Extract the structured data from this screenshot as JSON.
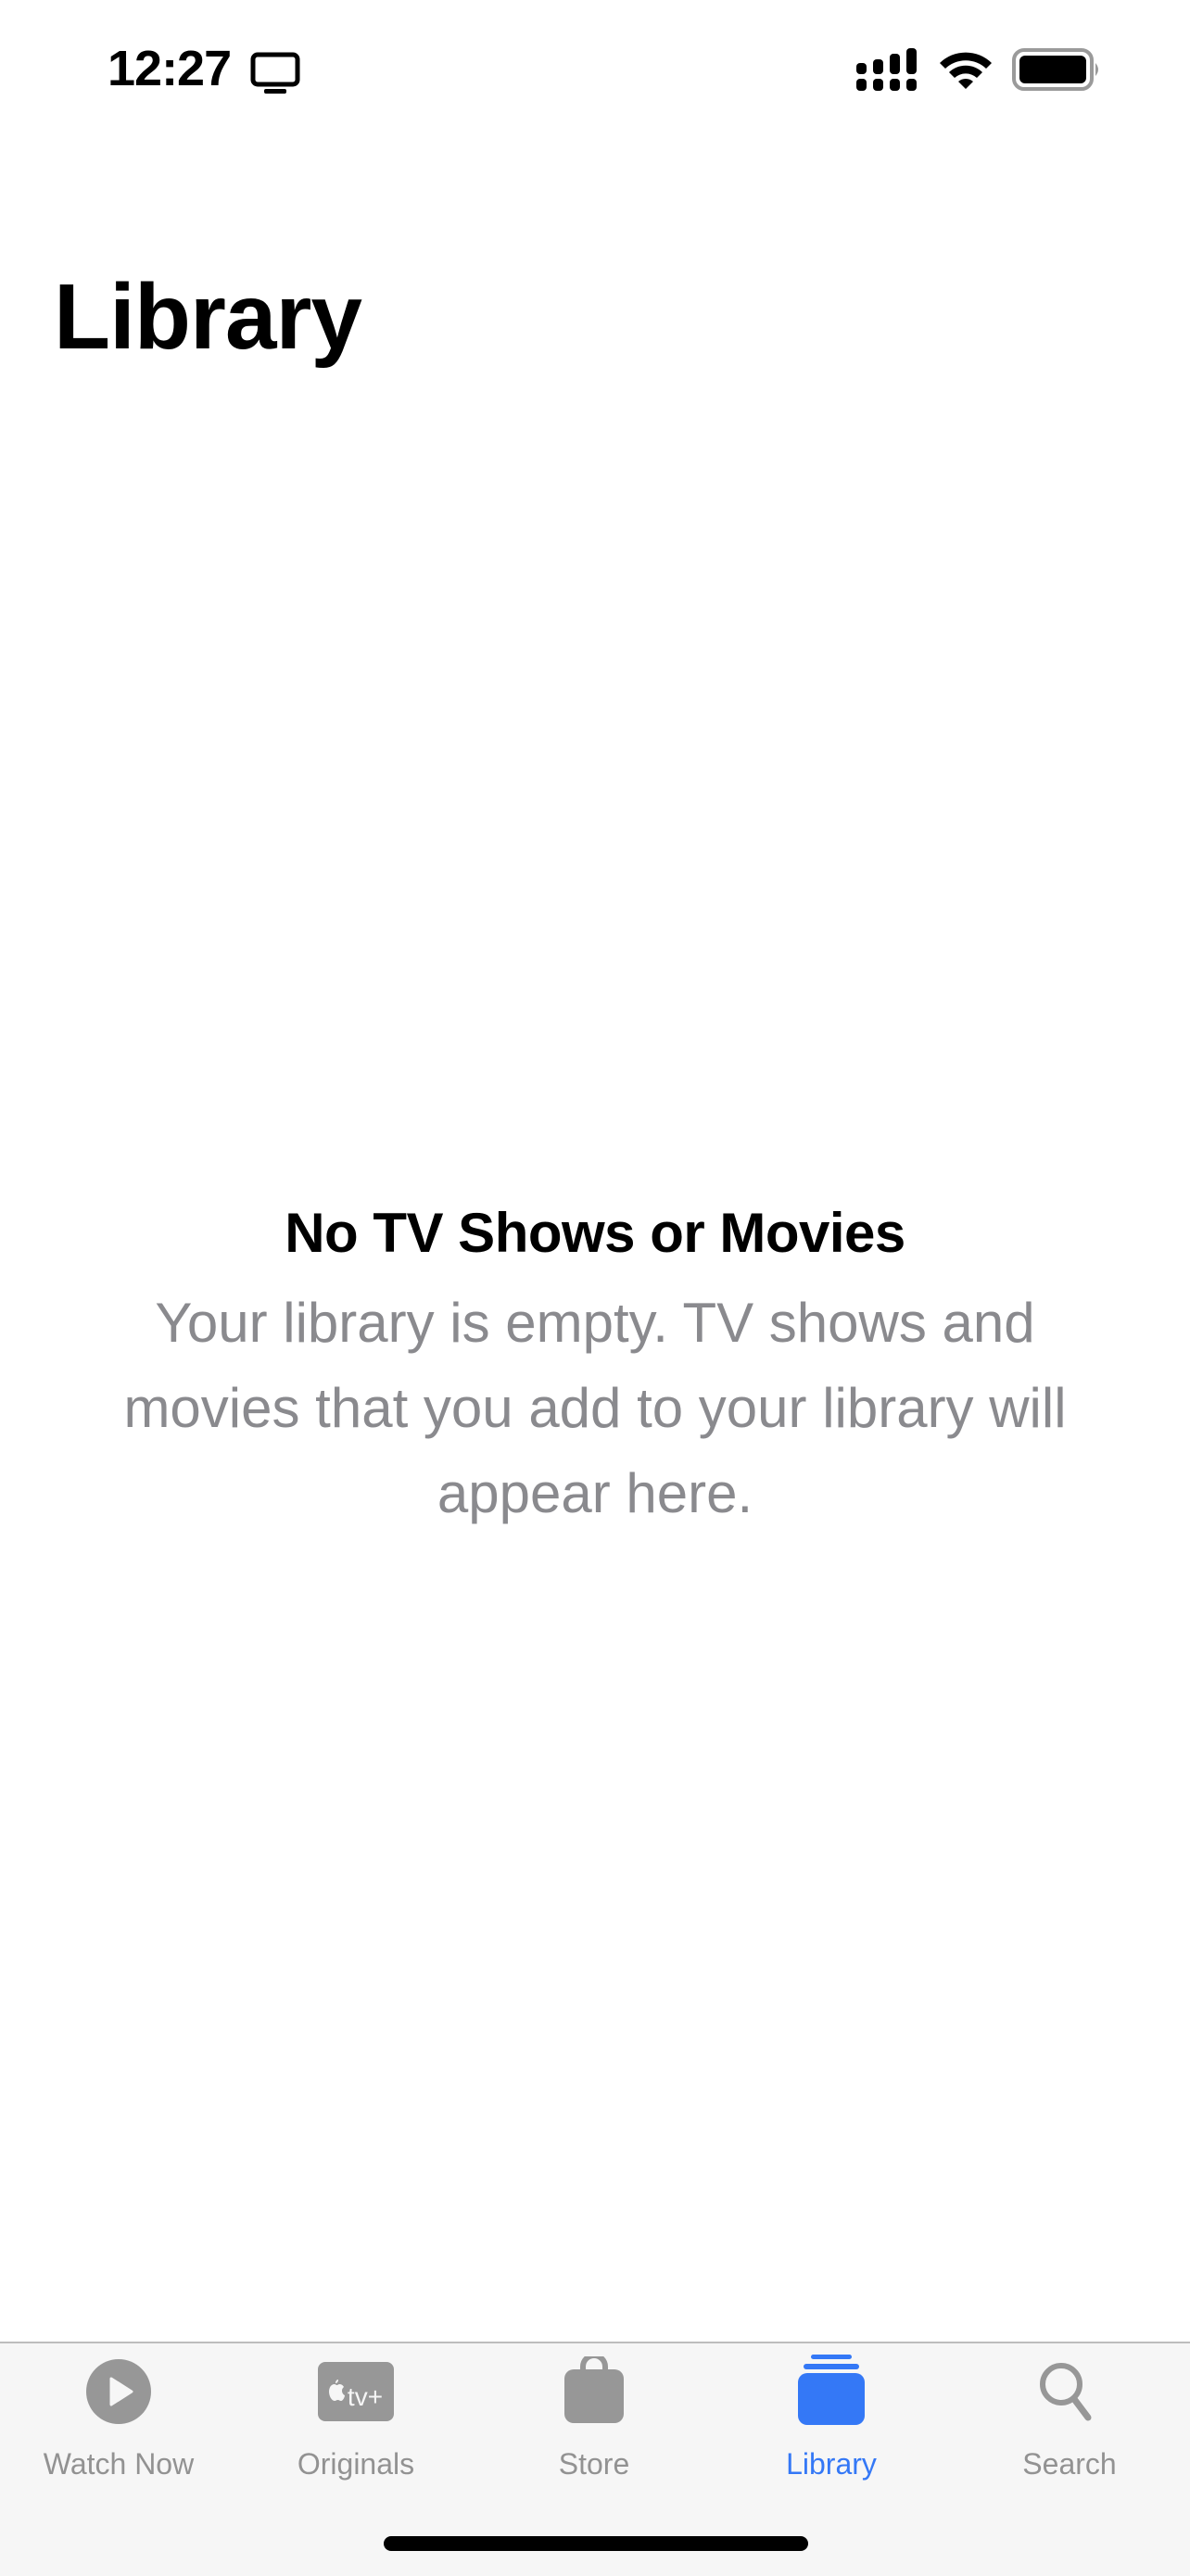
{
  "status_bar": {
    "time": "12:27",
    "icons": [
      "tv-icon",
      "cellular-signal-icon",
      "wifi-icon",
      "battery-icon"
    ]
  },
  "header": {
    "title": "Library"
  },
  "empty_state": {
    "title": "No TV Shows or Movies",
    "description": "Your library is empty. TV shows and movies that you add to your library will appear here."
  },
  "tab_bar": {
    "active_color": "#3478f6",
    "inactive_color": "#929292",
    "tabs": [
      {
        "label": "Watch Now",
        "icon": "play-circle-icon",
        "active": false
      },
      {
        "label": "Originals",
        "icon": "apple-tv-plus-icon",
        "icon_text": "tv+",
        "active": false
      },
      {
        "label": "Store",
        "icon": "shopping-bag-icon",
        "active": false
      },
      {
        "label": "Library",
        "icon": "library-stack-icon",
        "active": true
      },
      {
        "label": "Search",
        "icon": "magnifying-glass-icon",
        "active": false
      }
    ]
  }
}
